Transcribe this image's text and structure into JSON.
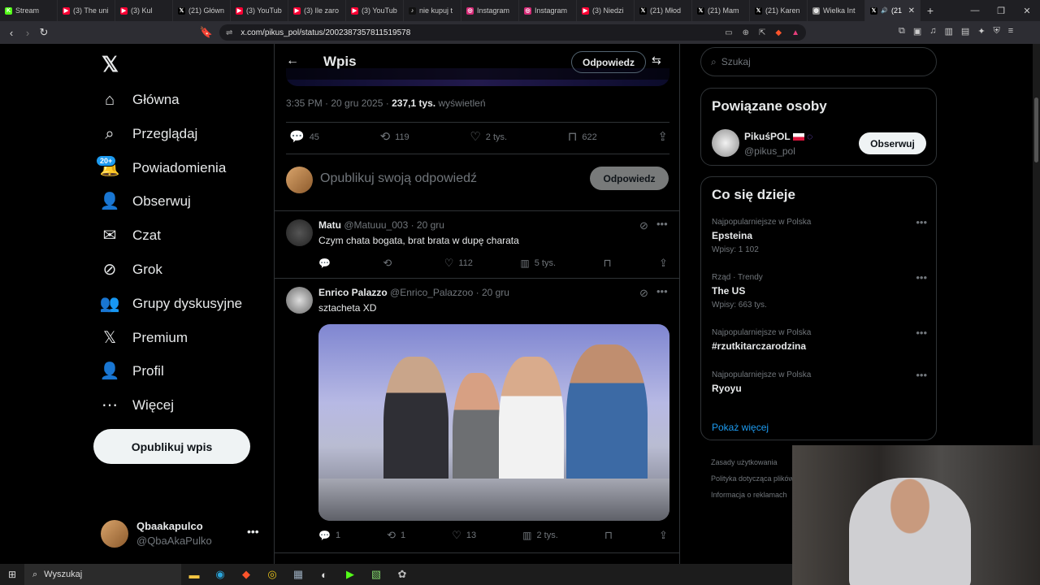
{
  "browser": {
    "tabs": [
      {
        "label": "Stream",
        "icon": "kick-icon",
        "color": "#53fc18"
      },
      {
        "label": "(3) The uni",
        "icon": "youtube-icon",
        "color": "#ff0033"
      },
      {
        "label": "(3) Kul",
        "icon": "youtube-icon",
        "color": "#ff0033"
      },
      {
        "label": "(21) Główn",
        "icon": "x-icon",
        "color": "#e7e9ea"
      },
      {
        "label": "(3) YouTub",
        "icon": "youtube-icon",
        "color": "#ff0033"
      },
      {
        "label": "(3) Ile zaro",
        "icon": "youtube-icon",
        "color": "#ff0033"
      },
      {
        "label": "(3) YouTub",
        "icon": "youtube-icon",
        "color": "#ff0033"
      },
      {
        "label": "nie kupuj t",
        "icon": "tiktok-icon",
        "color": "#111111"
      },
      {
        "label": "Instagram",
        "icon": "instagram-icon",
        "color": "#d62976"
      },
      {
        "label": "Instagram",
        "icon": "instagram-icon",
        "color": "#d62976"
      },
      {
        "label": "(3) Niedzi",
        "icon": "youtube-icon",
        "color": "#ff0033"
      },
      {
        "label": "(21) Młod",
        "icon": "x-icon",
        "color": "#e7e9ea"
      },
      {
        "label": "(21) Mam",
        "icon": "x-icon",
        "color": "#e7e9ea"
      },
      {
        "label": "(21) Karen",
        "icon": "x-icon",
        "color": "#e7e9ea"
      },
      {
        "label": "Wielka Int",
        "icon": "globe-icon",
        "color": "#888888"
      }
    ],
    "active_tab": {
      "label": "(21",
      "icon": "x-icon"
    },
    "url": "x.com/pikus_pol/status/2002387357811519578"
  },
  "nav": {
    "items": [
      {
        "label": "Główna",
        "icon": "home-icon"
      },
      {
        "label": "Przeglądaj",
        "icon": "search-icon"
      },
      {
        "label": "Powiadomienia",
        "icon": "bell-icon"
      },
      {
        "label": "Obserwuj",
        "icon": "follow-icon"
      },
      {
        "label": "Czat",
        "icon": "mail-icon"
      },
      {
        "label": "Grok",
        "icon": "grok-icon"
      },
      {
        "label": "Grupy dyskusyjne",
        "icon": "communities-icon"
      },
      {
        "label": "Premium",
        "icon": "x-icon"
      },
      {
        "label": "Profil",
        "icon": "profile-icon"
      },
      {
        "label": "Więcej",
        "icon": "more-icon"
      }
    ],
    "notif_badge": "20+",
    "post_button": "Opublikuj wpis",
    "user": {
      "name": "Qbaakapulco",
      "handle": "@QbaAkaPulko"
    }
  },
  "post": {
    "header_title": "Wpis",
    "header_reply": "Odpowiedz",
    "time": "3:35 PM · 20 gru 2025 ·",
    "views": "237,1 tys.",
    "views_label": "wyświetleń",
    "stats": {
      "replies": "45",
      "reposts": "119",
      "likes": "2 tys.",
      "bookmarks": "622"
    },
    "compose_placeholder": "Opublikuj swoją odpowiedź",
    "compose_button": "Odpowiedz"
  },
  "replies": [
    {
      "name": "Matu",
      "handle": "@Matuuu_003 · 20 gru",
      "text": "Czym chata bogata, brat brata w dupę charata",
      "replies": "",
      "reposts": "",
      "likes": "112",
      "views": "5 tys."
    },
    {
      "name": "Enrico Palazzo",
      "handle": "@Enrico_Palazzoo · 20 gru",
      "text": "sztacheta XD",
      "replies": "1",
      "reposts": "1",
      "likes": "13",
      "views": "2 tys."
    }
  ],
  "right": {
    "search_placeholder": "Szukaj",
    "related_title": "Powiązane osoby",
    "related_person": {
      "name": "PikuśPOL",
      "handle": "@pikus_pol",
      "follow": "Obserwuj"
    },
    "trends_title": "Co się dzieje",
    "trends": [
      {
        "category": "Najpopularniejsze w Polska",
        "topic": "Epsteina",
        "count": "Wpisy: 1 102"
      },
      {
        "category": "Rząd · Trendy",
        "topic": "The US",
        "count": "Wpisy: 663 tys."
      },
      {
        "category": "Najpopularniejsze w Polska",
        "topic": "#rzutkitarczarodzina",
        "count": ""
      },
      {
        "category": "Najpopularniejsze w Polska",
        "topic": "Ryoyu",
        "count": ""
      }
    ],
    "show_more": "Pokaż więcej",
    "footer": [
      "Zasady użytkowania",
      "Polityka dotycząca plików",
      "Informacja o reklamach"
    ]
  },
  "taskbar": {
    "search": "Wyszukaj"
  }
}
